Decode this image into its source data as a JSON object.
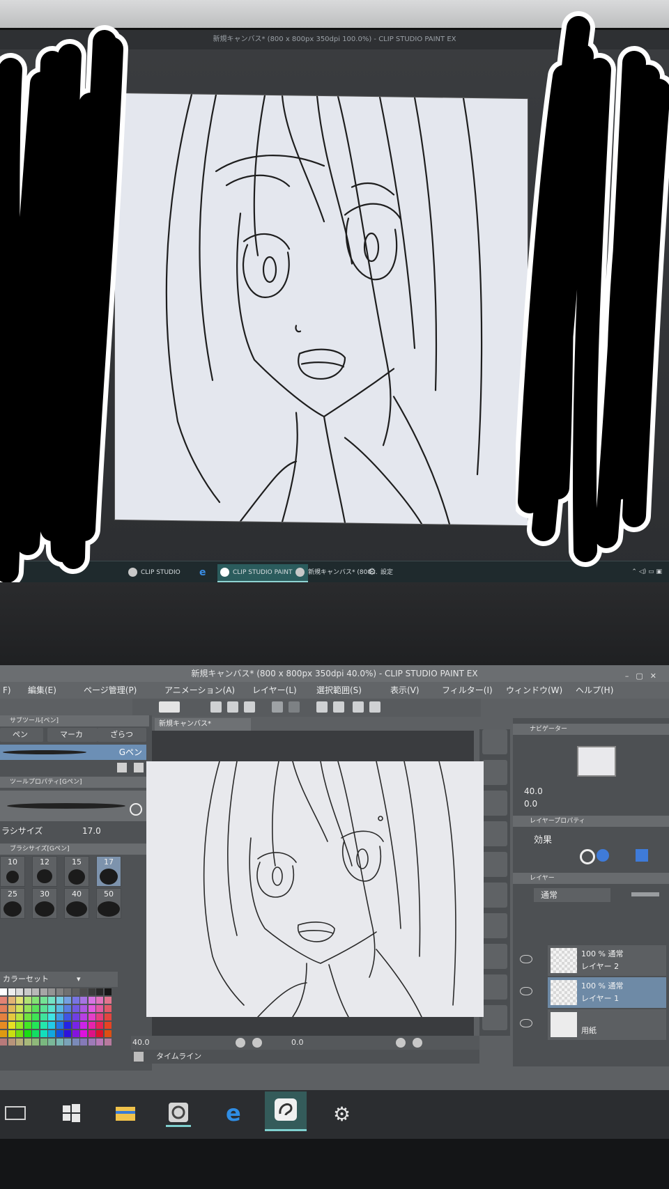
{
  "top_window": {
    "title": "新規キャンバス* (800 x 800px 350dpi 100.0%) - CLIP STUDIO PAINT EX",
    "taskbar_items": [
      "CLIP STUDIO",
      "CLIP STUDIO PAINT",
      "新規キャンバス* (800...",
      "設定"
    ]
  },
  "bottom_window": {
    "title": "新規キャンバス* (800 x 800px 350dpi 40.0%) - CLIP STUDIO PAINT EX",
    "menu": [
      "F)",
      "編集(E)",
      "ページ管理(P)",
      "アニメーション(A)",
      "レイヤー(L)",
      "選択範囲(S)",
      "表示(V)",
      "フィルター(I)",
      "ウィンドウ(W)",
      "ヘルプ(H)"
    ],
    "sub_tool_header": "サブツール[ペン]",
    "sub_tool_tabs": [
      "ペン",
      "マーカ",
      "ざらつ"
    ],
    "selected_brush": "Gペン",
    "tool_property_header": "ツールプロパティ[Gペン]",
    "brush_size_label": "ラシサイズ",
    "brush_size_value": "17.0",
    "brush_size_panel_header": "ブラシサイズ[Gペン]",
    "brush_sizes": [
      "10",
      "12",
      "15",
      "17",
      "25",
      "30",
      "40",
      "50"
    ],
    "selected_size": "17",
    "color_set_label": "カラーセット",
    "canvas_tab": "新規キャンバス*",
    "zoom_value": "40.0",
    "rotation_value": "0.0",
    "timeline_label": "タイムライン",
    "navigator_header": "ナビゲーター",
    "navigator_zoom": "40.0",
    "navigator_rotation": "0.0",
    "layer_property_header": "レイヤープロパティ",
    "effect_label": "効果",
    "layer_panel_header": "レイヤー",
    "blend_mode": "通常",
    "layers": [
      {
        "line1": "100 % 通常",
        "line2": "レイヤー 2",
        "selected": false
      },
      {
        "line1": "100 % 通常",
        "line2": "レイヤー 1",
        "selected": true
      },
      {
        "line1": "",
        "line2": "用紙",
        "selected": false
      }
    ]
  },
  "colors": {
    "accent_selected": "#6c8fb5",
    "taskbar_active": "#2b5c5d",
    "canvas_paper": "#e8e9ed"
  }
}
